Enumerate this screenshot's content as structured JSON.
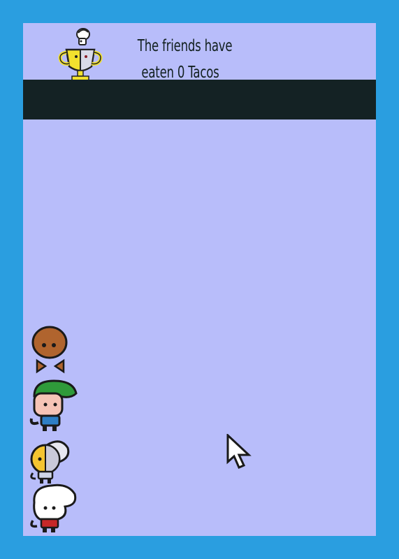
{
  "score": {
    "line1": "The friends have",
    "line2_prefix": "eaten",
    "tacos_eaten": "0",
    "line2_suffix": "Tacos"
  },
  "characters": [
    {
      "name": "taco-buddy",
      "icon": "taco-creature-icon"
    },
    {
      "name": "green-cap-kid",
      "icon": "green-cap-character-icon"
    },
    {
      "name": "yellow-half-kid",
      "icon": "yellow-half-character-icon"
    },
    {
      "name": "white-hair-kid",
      "icon": "white-hair-character-icon"
    }
  ],
  "colors": {
    "border": "#2a9ee0",
    "playfield": "#b8bdfa",
    "band": "#142224"
  }
}
